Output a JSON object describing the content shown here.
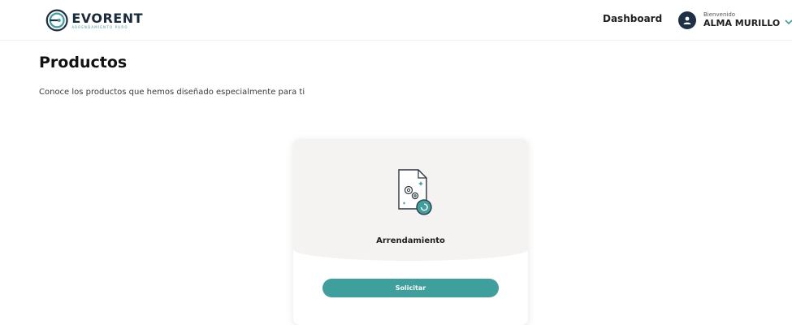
{
  "header": {
    "logo_word": "EVORENT",
    "logo_tagline": "ARRENDAMIENTO PURO",
    "nav_dashboard": "Dashboard",
    "user_greeting": "Bienvenido",
    "user_name": "ALMA MURILLO"
  },
  "main": {
    "title": "Productos",
    "subtitle": "Conoce los productos que hemos diseñado especialmente para ti"
  },
  "products": [
    {
      "label": "Arrendamiento",
      "button_label": "Solicitar",
      "icon": "document-gears-refresh-icon"
    }
  ],
  "colors": {
    "accent": "#3e9f9d",
    "dark": "#1f2f45",
    "card_top": "#f4f3f1"
  }
}
